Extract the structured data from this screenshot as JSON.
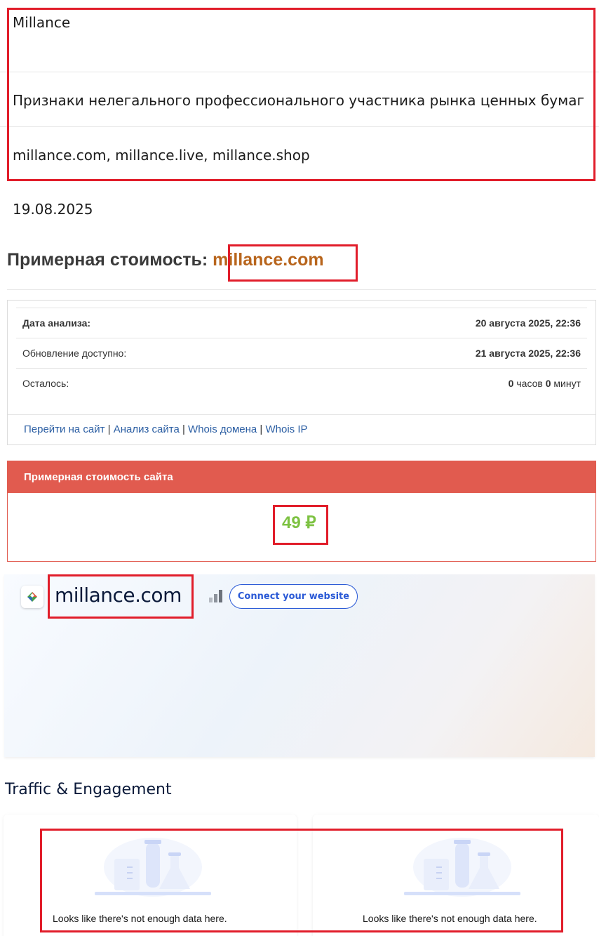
{
  "info": {
    "name": "Millance",
    "sign": "Признаки нелегального профессионального участника рынка ценных бумаг",
    "domains": "millance.com, millance.live, millance.shop",
    "date": "19.08.2025"
  },
  "price": {
    "title": "Примерная стоимость: ",
    "domain": "millance.com"
  },
  "analysis": {
    "date_label": "Дата анализа:",
    "date_value": "20 августа 2025, 22:36",
    "update_label": "Обновление доступно:",
    "update_value": "21 августа 2025, 22:36",
    "left_label": "Осталось:",
    "left_hours": "0",
    "left_hours_unit": " часов ",
    "left_minutes": "0",
    "left_minutes_unit": " минут",
    "links": [
      "Перейти на сайт",
      "Анализ сайта",
      "Whois домена",
      "Whois IP"
    ],
    "link_separator": " | "
  },
  "cost": {
    "header": "Примерная стоимость сайта",
    "value": "49 ₽"
  },
  "sw": {
    "domain": "millance.com",
    "connect_label": "Connect your website",
    "traffic_title": "Traffic & Engagement",
    "empty_message_1": "Looks like there's not enough data here.",
    "empty_message_2": "Looks like there's not enough data here."
  },
  "icons": {
    "favicon": "diamond-favicon-icon",
    "rank": "rank-bars-icon",
    "empty": "lab-flasks-illustration"
  },
  "colors": {
    "highlight": "#e11d2a",
    "domain_orange": "#b8651c",
    "cost_header": "#e15b4f",
    "cost_value": "#7dc242",
    "link": "#2b5ea3",
    "connect_blue": "#2b5ad6"
  }
}
